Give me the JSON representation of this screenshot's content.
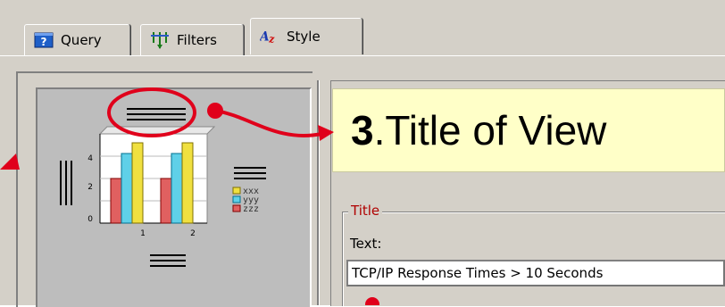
{
  "tabs": [
    {
      "label": "Query",
      "icon": "question-icon",
      "active": false
    },
    {
      "label": "Filters",
      "icon": "filters-icon",
      "active": false
    },
    {
      "label": "Style",
      "icon": "az-icon",
      "active": true
    }
  ],
  "callout": {
    "number": "3",
    "text": ".Title of View"
  },
  "title_group": {
    "label": "Title",
    "text_label": "Text:",
    "text_value": "TCP/IP Response Times > 10 Seconds"
  },
  "preview": {
    "y_ticks": [
      "4",
      "2",
      "0"
    ],
    "x_ticks": [
      "1",
      "2"
    ],
    "legend": [
      "xxx",
      "yyy",
      "zzz"
    ]
  },
  "colors": {
    "annotation": "#e0001b",
    "callout_bg": "#ffffc8",
    "group_label": "#b00000"
  }
}
